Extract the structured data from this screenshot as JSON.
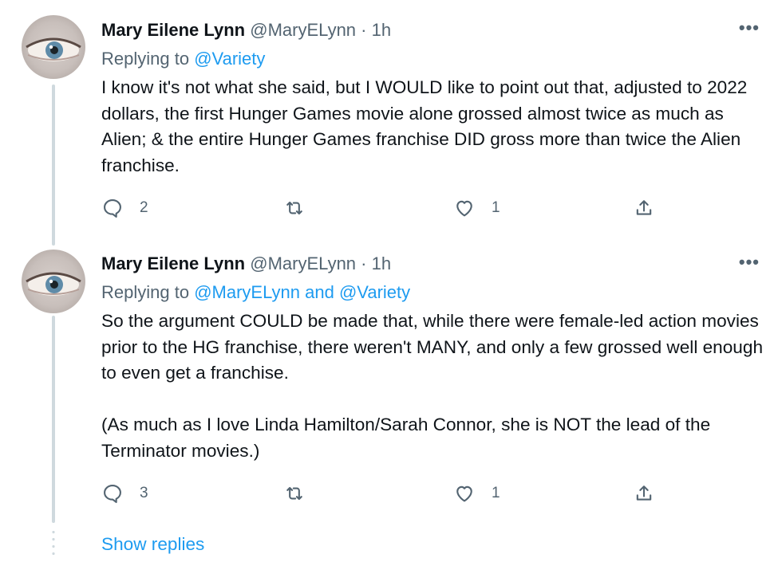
{
  "tweets": [
    {
      "author_name": "Mary Eilene Lynn",
      "handle": "@MaryELynn",
      "separator": "·",
      "time": "1h",
      "more_label": "•••",
      "replying_prefix": "Replying to",
      "replying_mentions": [
        "@Variety"
      ],
      "replying_joiner": "",
      "paragraphs": [
        "I know it's not what she said, but I WOULD like to point out that, adjusted to 2022 dollars, the first Hunger Games movie alone grossed almost twice as much as Alien; & the entire Hunger Games franchise DID gross more than twice the Alien franchise."
      ],
      "reply_count": "2",
      "retweet_count": "",
      "like_count": "1"
    },
    {
      "author_name": "Mary Eilene Lynn",
      "handle": "@MaryELynn",
      "separator": "·",
      "time": "1h",
      "more_label": "•••",
      "replying_prefix": "Replying to",
      "replying_mentions": [
        "@MaryELynn",
        "@Variety"
      ],
      "replying_joiner": "and",
      "paragraphs": [
        "So the argument COULD be made that, while there were female-led action movies prior to the HG franchise, there weren't MANY, and only a few grossed well enough to even get a franchise.",
        "(As much as I love Linda Hamilton/Sarah Connor, she is NOT the lead of the Terminator movies.)"
      ],
      "reply_count": "3",
      "retweet_count": "",
      "like_count": "1"
    }
  ],
  "show_replies_label": "Show replies",
  "icons": {
    "reply": "reply-bubble-icon",
    "retweet": "retweet-icon",
    "like": "heart-icon",
    "share": "share-icon",
    "more": "more-dots-icon"
  },
  "colors": {
    "link": "#1d9bf0",
    "secondary_text": "#536471",
    "primary_text": "#0f1419",
    "thread_line": "#cfd9de"
  }
}
